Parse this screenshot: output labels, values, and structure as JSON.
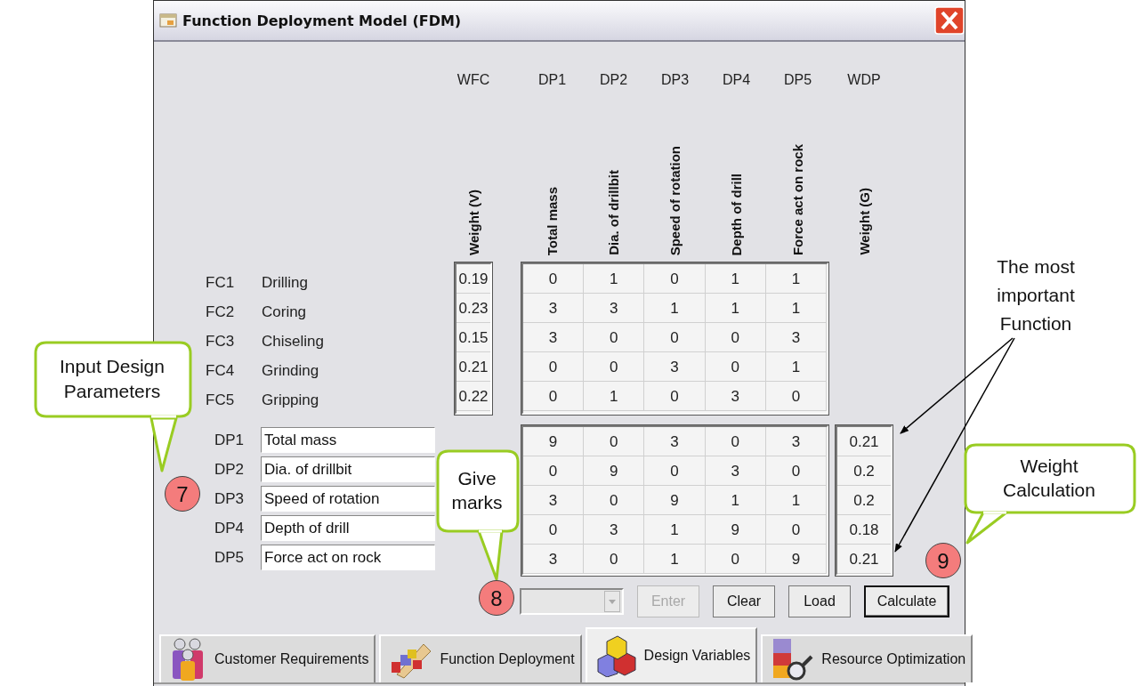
{
  "window": {
    "title": "Function Deployment Model (FDM)"
  },
  "columns": [
    {
      "code": "WFC",
      "label": "Weight (V)"
    },
    {
      "code": "DP1",
      "label": "Total mass"
    },
    {
      "code": "DP2",
      "label": "Dia. of drillbit"
    },
    {
      "code": "DP3",
      "label": "Speed of rotation"
    },
    {
      "code": "DP4",
      "label": "Depth of drill"
    },
    {
      "code": "DP5",
      "label": "Force act on rock"
    },
    {
      "code": "WDP",
      "label": "Weight (G)"
    }
  ],
  "functions": [
    {
      "code": "FC1",
      "name": "Drilling",
      "weight": "0.19",
      "marks": [
        "0",
        "1",
        "0",
        "1",
        "1"
      ]
    },
    {
      "code": "FC2",
      "name": "Coring",
      "weight": "0.23",
      "marks": [
        "3",
        "3",
        "1",
        "1",
        "1"
      ]
    },
    {
      "code": "FC3",
      "name": "Chiseling",
      "weight": "0.15",
      "marks": [
        "3",
        "0",
        "0",
        "0",
        "3"
      ]
    },
    {
      "code": "FC4",
      "name": "Grinding",
      "weight": "0.21",
      "marks": [
        "0",
        "0",
        "3",
        "0",
        "1"
      ]
    },
    {
      "code": "FC5",
      "name": "Gripping",
      "weight": "0.22",
      "marks": [
        "0",
        "1",
        "0",
        "3",
        "0"
      ]
    }
  ],
  "design_parameters": [
    {
      "code": "DP1",
      "value": "Total mass",
      "marks": [
        "9",
        "0",
        "3",
        "0",
        "3"
      ],
      "weight": "0.21"
    },
    {
      "code": "DP2",
      "value": "Dia. of drillbit",
      "marks": [
        "0",
        "9",
        "0",
        "3",
        "0"
      ],
      "weight": "0.2"
    },
    {
      "code": "DP3",
      "value": "Speed of rotation",
      "marks": [
        "3",
        "0",
        "9",
        "1",
        "1"
      ],
      "weight": "0.2"
    },
    {
      "code": "DP4",
      "value": "Depth of drill",
      "marks": [
        "0",
        "3",
        "1",
        "9",
        "0"
      ],
      "weight": "0.18"
    },
    {
      "code": "DP5",
      "value": "Force act on rock",
      "marks": [
        "3",
        "0",
        "1",
        "0",
        "9"
      ],
      "weight": "0.21"
    }
  ],
  "mark_select": {
    "disabled": true
  },
  "buttons": [
    {
      "label": "Enter",
      "disabled": true,
      "default": false
    },
    {
      "label": "Clear",
      "disabled": false,
      "default": false
    },
    {
      "label": "Load",
      "disabled": false,
      "default": false
    },
    {
      "label": "Calculate",
      "disabled": false,
      "default": true
    }
  ],
  "tabs": [
    {
      "label": "Customer Requirements",
      "selected": false
    },
    {
      "label": "Function Deployment",
      "selected": false
    },
    {
      "label": "Design Variables",
      "selected": true
    },
    {
      "label": "Resource Optimization",
      "selected": false
    }
  ],
  "callouts": [
    {
      "text": "Input Design Parameters"
    },
    {
      "text": "Give marks"
    },
    {
      "text": "Weight Calculation"
    }
  ],
  "note": "The most important Function",
  "step_markers": [
    "7",
    "8",
    "9"
  ]
}
